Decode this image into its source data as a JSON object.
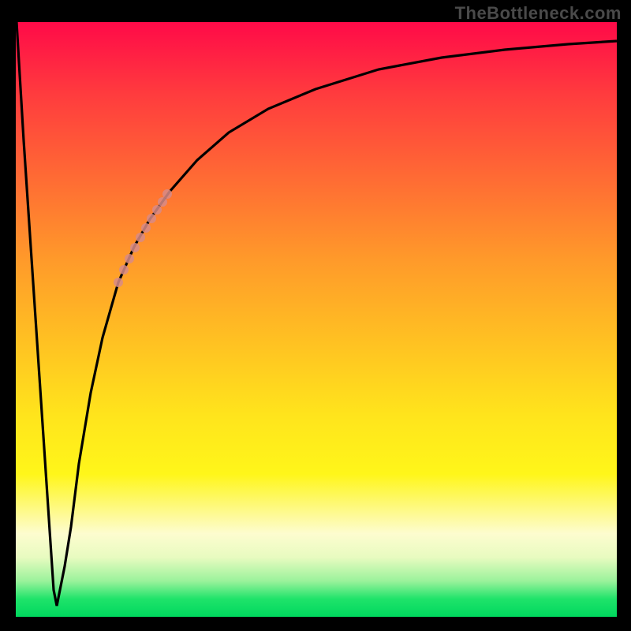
{
  "watermark": "TheBottleneck.com",
  "chart_data": {
    "type": "line",
    "title": "",
    "xlabel": "",
    "ylabel": "",
    "xlim": [
      0,
      100
    ],
    "ylim": [
      0,
      100
    ],
    "grid": false,
    "legend": false,
    "series": [
      {
        "name": "bottleneck-curve",
        "color": "#000000",
        "x": [
          0,
          1,
          2,
          3,
          4,
          5,
          6,
          7,
          8,
          9,
          10,
          12,
          14,
          16,
          18,
          20,
          22,
          25,
          30,
          35,
          40,
          50,
          60,
          70,
          80,
          90,
          100
        ],
        "y": [
          100,
          80,
          60,
          40,
          20,
          4,
          2,
          8,
          18,
          27,
          35,
          46,
          54,
          60,
          65,
          69,
          72,
          76,
          82,
          86,
          88,
          91,
          93,
          94.5,
          95.5,
          96.2,
          96.8
        ]
      }
    ],
    "highlight": {
      "name": "highlight-segment",
      "color": "#d98b87",
      "x": [
        16,
        17,
        18,
        19,
        20,
        21,
        22,
        22.8
      ],
      "y": [
        60,
        62.5,
        65,
        67,
        69,
        70.5,
        72,
        73
      ]
    },
    "gradient_stops": [
      {
        "pos": 0,
        "color": "#ff0a48"
      },
      {
        "pos": 50,
        "color": "#ffe41c"
      },
      {
        "pos": 88,
        "color": "#fdfccf"
      },
      {
        "pos": 100,
        "color": "#00d85e"
      }
    ]
  }
}
